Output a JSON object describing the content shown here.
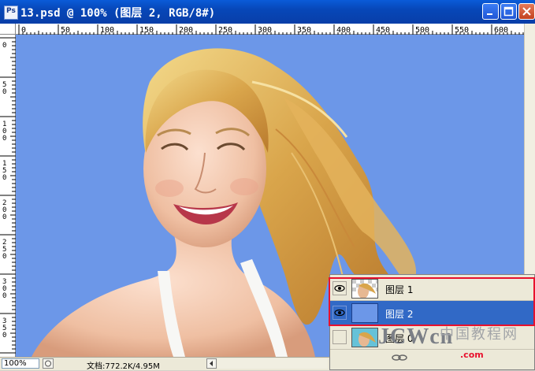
{
  "window": {
    "title": "13.psd @ 100% (图层 2, RGB/8#)",
    "app_icon": "Ps"
  },
  "rulers": {
    "horizontal": [
      "0",
      "50",
      "100",
      "150",
      "200",
      "250",
      "300",
      "350",
      "400",
      "450",
      "500",
      "550",
      "600"
    ],
    "vertical": [
      "0",
      "5\n0",
      "1\n0\n0",
      "1\n5\n0",
      "2\n0\n0",
      "2\n5\n0",
      "3\n0\n0",
      "3\n5\n0"
    ]
  },
  "canvas": {
    "background_color": "#6c97e8",
    "content": "photo-woman-blonde-hair"
  },
  "statusbar": {
    "zoom": "100%",
    "doc_size": "文档:772.2K/4.95M"
  },
  "layers_panel": {
    "layers": [
      {
        "name": "图层 1",
        "visible": true,
        "selected": false,
        "thumb": "checker-photo"
      },
      {
        "name": "图层 2",
        "visible": true,
        "selected": true,
        "thumb": "blue-fill"
      },
      {
        "name": "图层 0",
        "visible": false,
        "selected": false,
        "thumb": "photo"
      }
    ],
    "highlight_color": "#e8112d"
  },
  "watermark": {
    "main": "JCWcn",
    "cn": "中国教程网",
    "url": ".com"
  }
}
